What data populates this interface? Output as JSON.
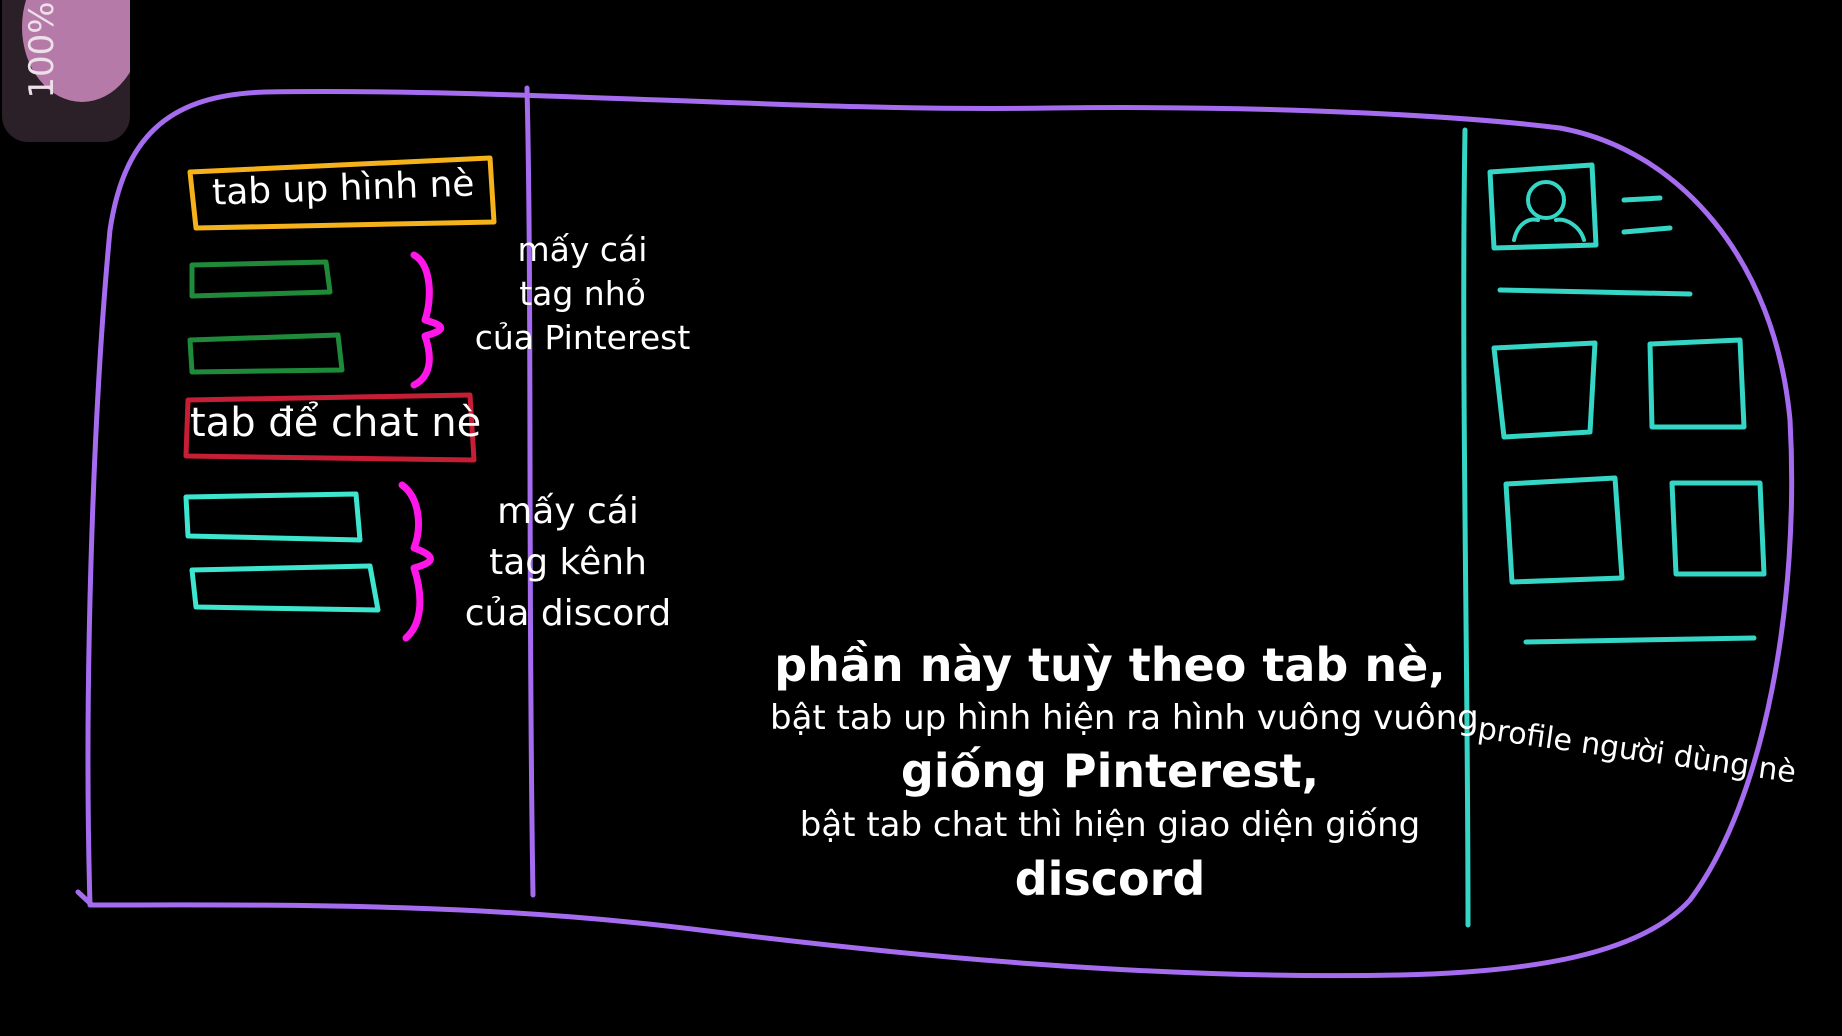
{
  "zoom_level": "100%",
  "sidebar": {
    "upload_tab_label": "tab up hình nè",
    "pinterest_tags_note": [
      "mấy cái",
      "tag nhỏ",
      "của Pinterest"
    ],
    "chat_tab_label": "tab để chat nè",
    "discord_tags_note": [
      "mấy cái",
      "tag kênh",
      "của discord"
    ]
  },
  "main": {
    "description": [
      "phần này tuỳ theo tab nè,",
      "bật tab up hình hiện ra hình vuông vuông",
      "giống Pinterest,",
      "bật tab chat thì hiện giao diện giống",
      "discord"
    ]
  },
  "profile": {
    "note": "profile người dùng nè"
  },
  "colors": {
    "frame": "#a66cf0",
    "upload_tab": "#f5b21a",
    "pinterest_tags": "#1f8a3a",
    "chat_tab": "#c61e35",
    "discord_tags": "#3ee6cf",
    "braces": "#ff16e8",
    "profile": "#35d6c6"
  }
}
